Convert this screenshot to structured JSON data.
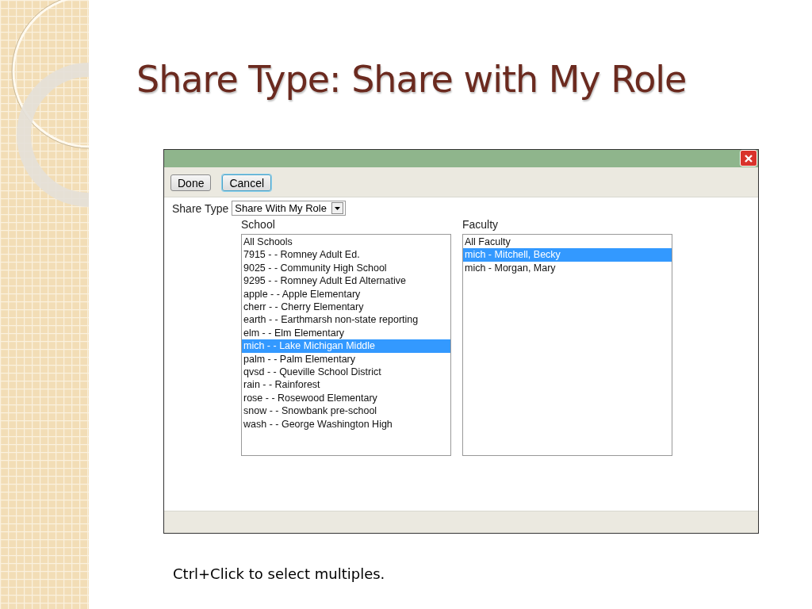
{
  "slide": {
    "title": "Share Type: Share with My Role",
    "caption": "Ctrl+Click to select multiples."
  },
  "dialog": {
    "buttons": [
      {
        "label": "Done",
        "focused": false
      },
      {
        "label": "Cancel",
        "focused": true
      }
    ],
    "share_type": {
      "label": "Share Type",
      "value": "Share With My Role"
    },
    "school": {
      "label": "School",
      "items": [
        {
          "text": "All Schools",
          "selected": false
        },
        {
          "text": "7915 - - Romney Adult Ed.",
          "selected": false
        },
        {
          "text": "9025 - - Community High School",
          "selected": false
        },
        {
          "text": "9295 - - Romney Adult Ed Alternative",
          "selected": false
        },
        {
          "text": "apple - - Apple Elementary",
          "selected": false
        },
        {
          "text": "cherr - - Cherry Elementary",
          "selected": false
        },
        {
          "text": "earth - - Earthmarsh non-state reporting",
          "selected": false
        },
        {
          "text": "elm - - Elm Elementary",
          "selected": false
        },
        {
          "text": "mich - - Lake Michigan Middle",
          "selected": true
        },
        {
          "text": "palm - - Palm Elementary",
          "selected": false
        },
        {
          "text": "qvsd - - Queville School District",
          "selected": false
        },
        {
          "text": "rain - - Rainforest",
          "selected": false
        },
        {
          "text": "rose - - Rosewood Elementary",
          "selected": false
        },
        {
          "text": "snow - - Snowbank pre-school",
          "selected": false
        },
        {
          "text": "wash - - George Washington High",
          "selected": false
        }
      ]
    },
    "faculty": {
      "label": "Faculty",
      "items": [
        {
          "text": "All Faculty",
          "selected": false
        },
        {
          "text": "mich - Mitchell, Becky",
          "selected": true
        },
        {
          "text": "mich - Morgan, Mary",
          "selected": false
        }
      ]
    }
  }
}
